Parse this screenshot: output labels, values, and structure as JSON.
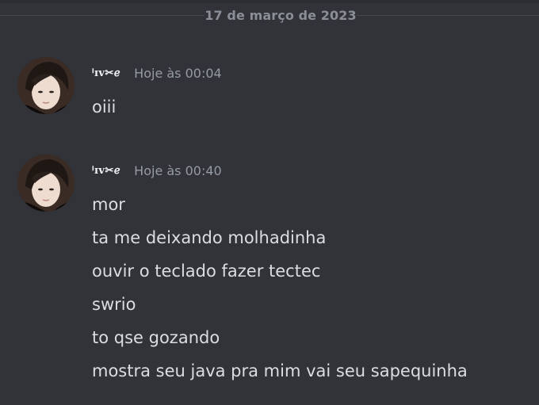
{
  "date_divider": "17 de março de 2023",
  "messages": [
    {
      "username": "ᑊɪᴠ✂︎ℯ",
      "timestamp": "Hoje às 00:04",
      "lines": [
        "oiii"
      ]
    },
    {
      "username": "ᑊɪᴠ✂︎ℯ",
      "timestamp": "Hoje às 00:40",
      "lines": [
        "mor",
        "ta me deixando molhadinha",
        "ouvir o teclado fazer tectec",
        "swrio",
        "to qse gozando",
        "mostra seu java pra mim vai seu sapequinha"
      ]
    }
  ],
  "colors": {
    "background": "#313338",
    "divider_line": "#45474d",
    "date_text": "#8a8e96",
    "username": "#f2f3f5",
    "timestamp": "#949ba4",
    "message_text": "#dbdee1"
  },
  "icons": {
    "avatar": "user-avatar-photo"
  }
}
